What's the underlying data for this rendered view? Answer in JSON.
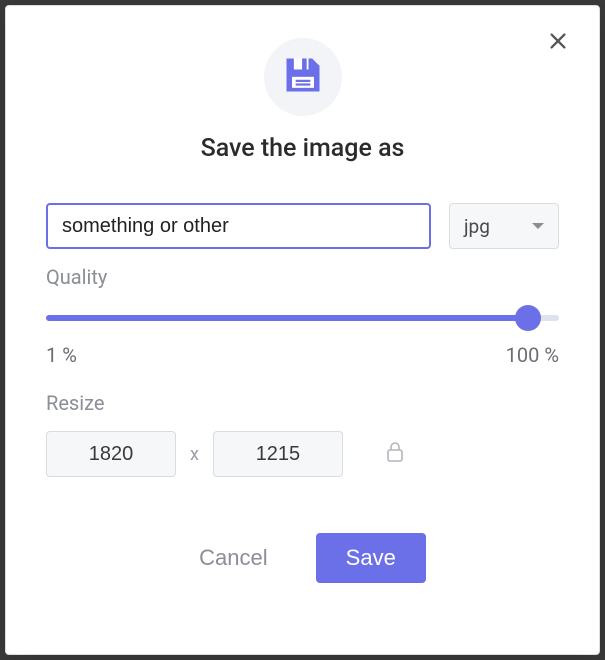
{
  "dialog": {
    "title": "Save the image as",
    "filename": "something or other",
    "format": {
      "selected": "jpg"
    },
    "quality": {
      "label": "Quality",
      "value": 94,
      "min_label": "1 %",
      "max_label": "100 %"
    },
    "resize": {
      "label": "Resize",
      "width": "1820",
      "height": "1215",
      "separator": "x",
      "locked": true
    },
    "buttons": {
      "cancel": "Cancel",
      "save": "Save"
    }
  }
}
